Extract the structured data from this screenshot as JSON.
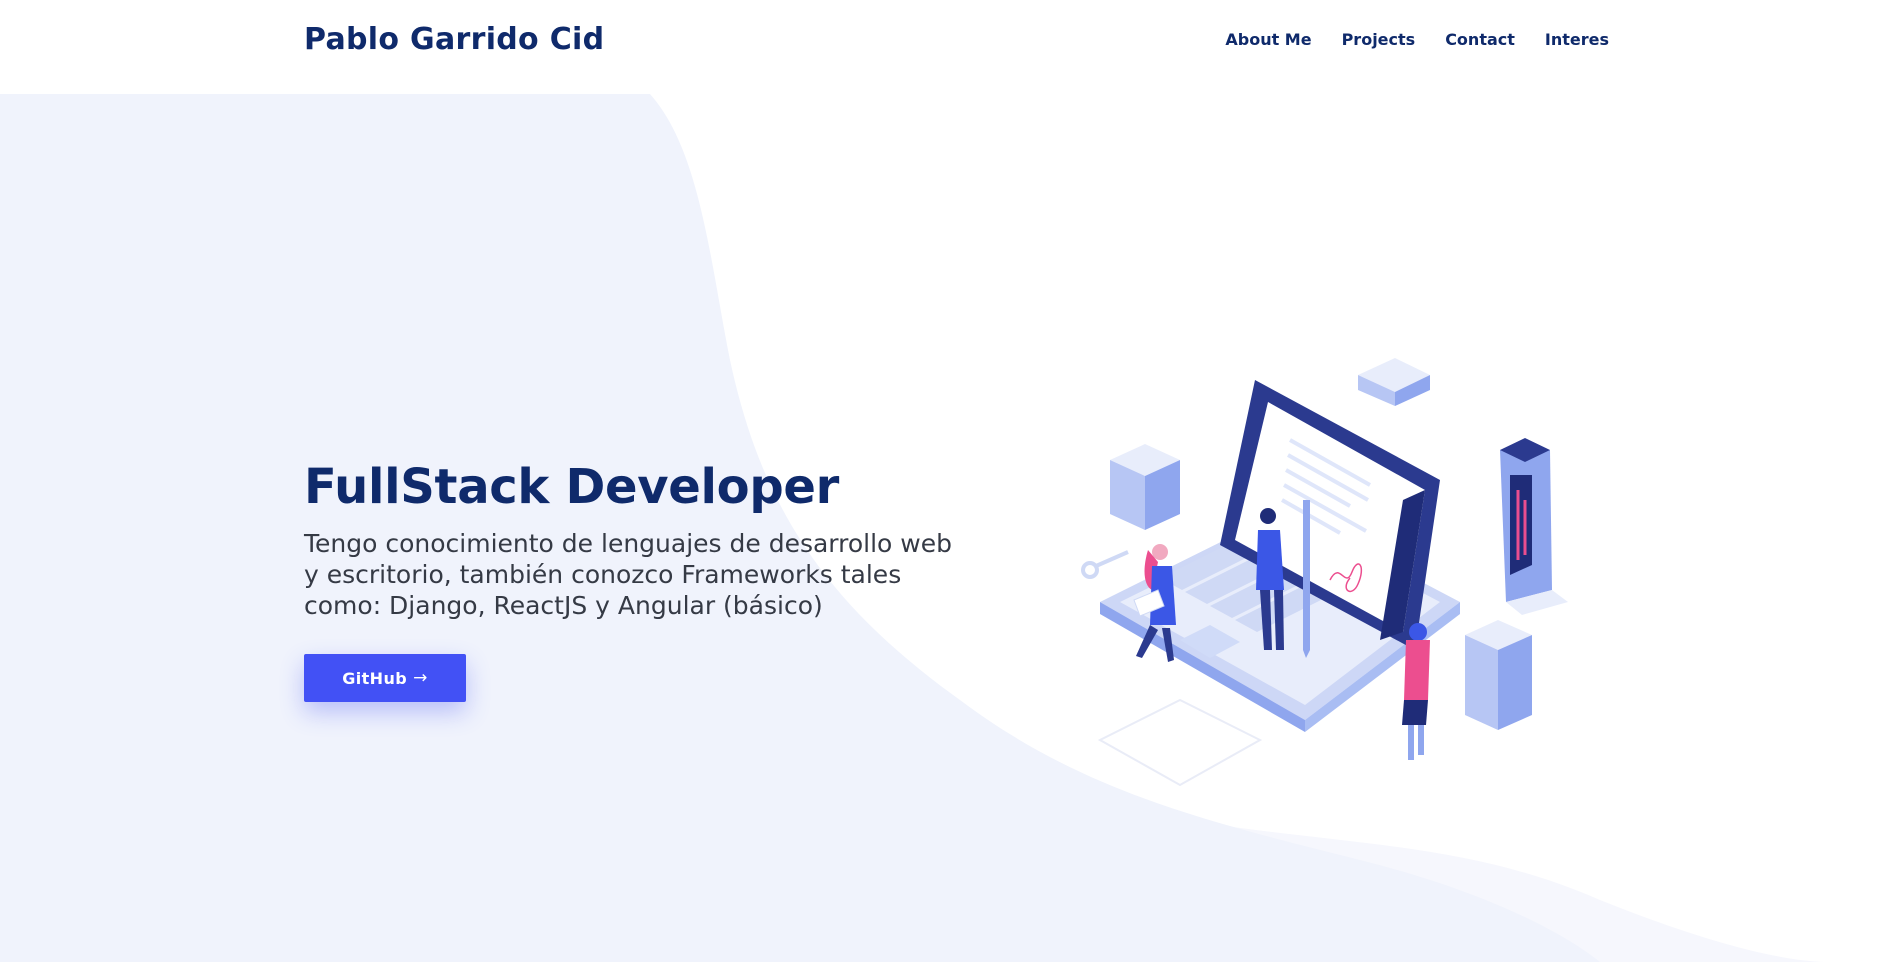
{
  "header": {
    "brand": "Pablo Garrido Cid",
    "nav": [
      {
        "label": "About Me"
      },
      {
        "label": "Projects"
      },
      {
        "label": "Contact"
      },
      {
        "label": "Interes"
      }
    ]
  },
  "hero": {
    "title": "FullStack Developer",
    "description": "Tengo conocimiento de lenguajes de desarrollo web y escritorio, también conozco Frameworks tales como: Django, ReactJS y Angular (básico)",
    "cta_label": "GitHub",
    "cta_icon": "arrow-right-icon"
  },
  "colors": {
    "primary": "#4251f5",
    "heading": "#0f2a6b",
    "text": "#353a45",
    "wave_light": "#f0f3fc",
    "wave_lighter": "#f6f7fd"
  }
}
